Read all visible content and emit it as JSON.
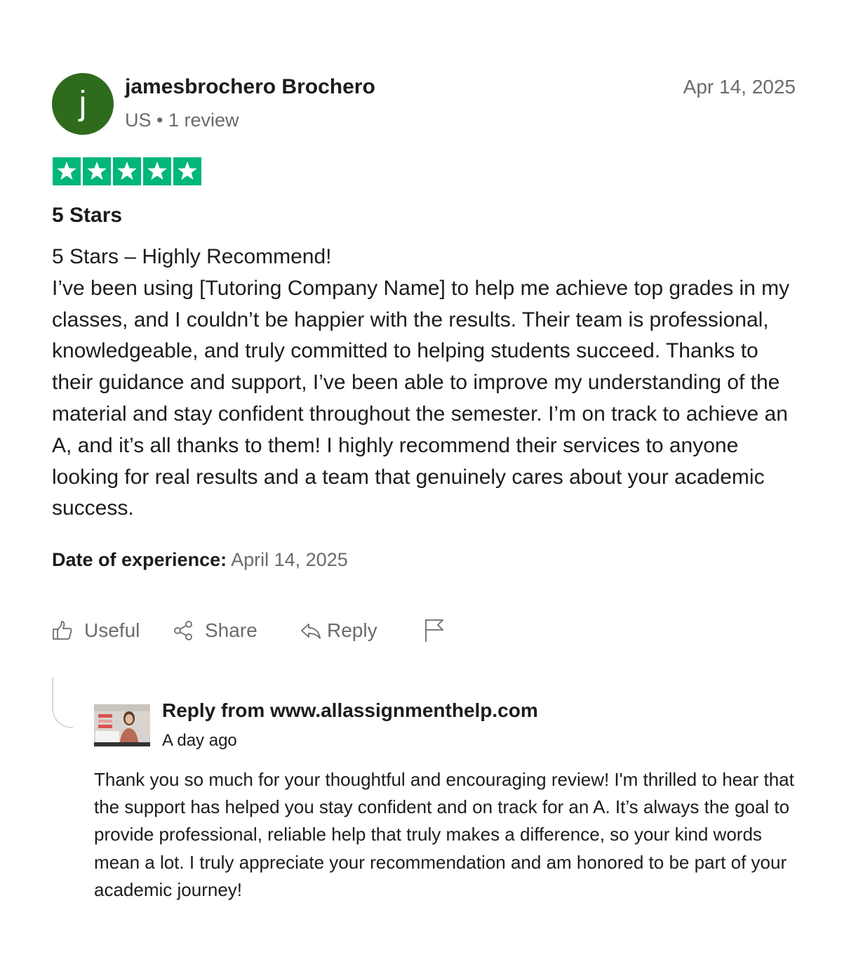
{
  "review": {
    "avatar_letter": "j",
    "avatar_color": "#2e6b1c",
    "reviewer_name": "jamesbrochero Brochero",
    "reviewer_meta": "US • 1 review",
    "date": "Apr 14, 2025",
    "rating": 5,
    "rating_max": 5,
    "star_color": "#00b67a",
    "title": "5 Stars",
    "body_heading": "5 Stars – Highly Recommend!",
    "body_text": "I’ve been using [Tutoring Company Name] to help me achieve top grades in my classes, and I couldn’t be happier with the results. Their team is professional, knowledgeable, and truly committed to helping students succeed. Thanks to their guidance and support, I’ve been able to improve my understanding of the material and stay confident throughout the semester. I’m on track to achieve an A, and it’s all thanks to them! I highly recommend their services to anyone looking for real results and a team that genuinely cares about your academic success.",
    "date_of_experience_label": "Date of experience:",
    "date_of_experience_value": "April 14, 2025"
  },
  "actions": {
    "useful_label": "Useful",
    "share_label": "Share",
    "reply_label": "Reply",
    "useful_icon": "thumbs-up-icon",
    "share_icon": "share-icon",
    "reply_icon": "reply-arrow-icon",
    "flag_icon": "flag-icon"
  },
  "reply": {
    "title": "Reply from www.allassignmenthelp.com",
    "time": "A day ago",
    "text": "Thank you so much for your thoughtful and encouraging review! I'm thrilled to hear that the support has helped you stay confident and on track for an A. It’s always the goal to provide professional, reliable help that truly makes a difference, so your kind words mean a lot. I truly appreciate your recommendation and am honored to be part of your academic journey!"
  }
}
